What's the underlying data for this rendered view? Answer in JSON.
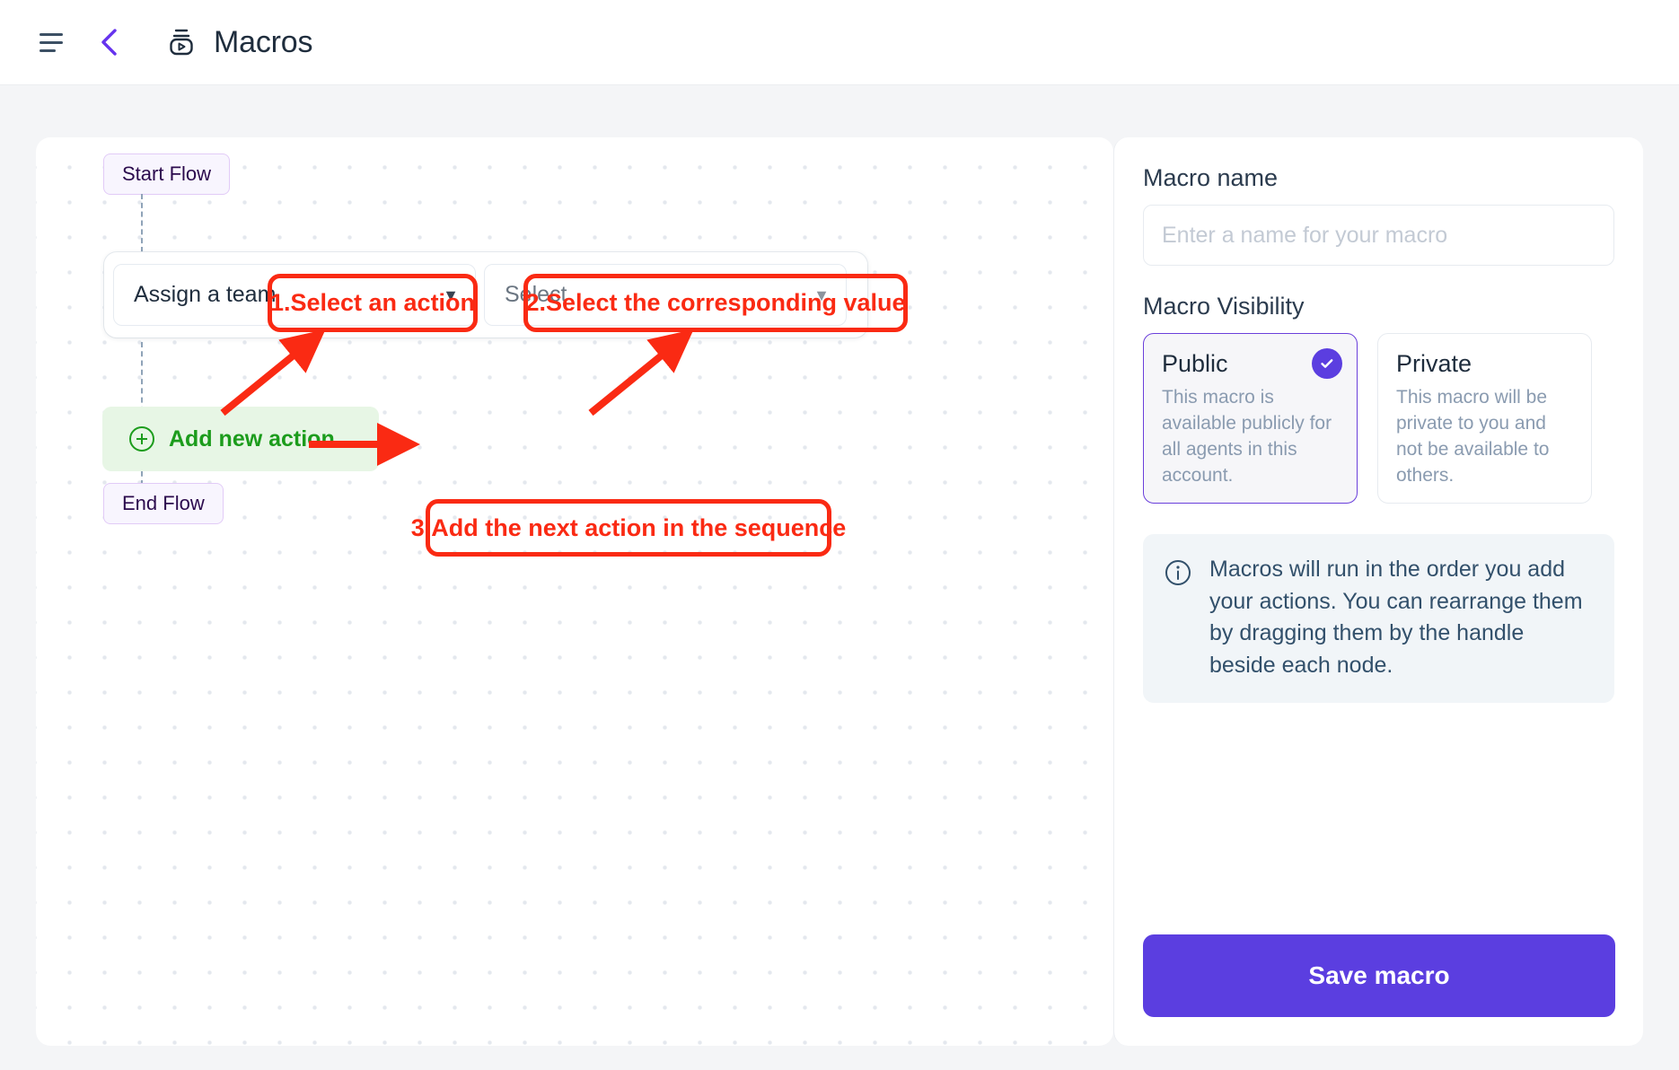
{
  "header": {
    "menu_icon": "hamburger-icon",
    "back_icon": "chevron-left-icon",
    "brand_icon": "macros-icon",
    "title": "Macros"
  },
  "canvas": {
    "start_node": "Start Flow",
    "end_node": "End Flow",
    "action_row": {
      "action_select_value": "Assign a team",
      "value_select_placeholder": "Select",
      "caret_icon": "chevron-down-icon"
    },
    "add_action": {
      "label": "Add new action",
      "icon": "plus-circle-icon"
    },
    "annotations": [
      {
        "id": "anno1",
        "text": "1.Select an action"
      },
      {
        "id": "anno2",
        "text": "2.Select the corresponding value"
      },
      {
        "id": "anno3",
        "text": "3.Add the next action in the sequence"
      }
    ],
    "annotation_color": "#fa2a13"
  },
  "panel": {
    "macro_name_label": "Macro name",
    "macro_name_value": "",
    "macro_name_placeholder": "Enter a name for your macro",
    "visibility_label": "Macro Visibility",
    "visibility_options": [
      {
        "title": "Public",
        "description": "This macro is available publicly for all agents in this account.",
        "selected": true,
        "check_icon": "check-icon"
      },
      {
        "title": "Private",
        "description": "This macro will be private to you and not be available to others.",
        "selected": false
      }
    ],
    "info": {
      "icon": "info-circle-icon",
      "text": "Macros will run in the order you add your actions. You can rearrange them by dragging them by the handle beside each node."
    },
    "save_label": "Save macro",
    "accent_color": "#5b3ee0"
  }
}
